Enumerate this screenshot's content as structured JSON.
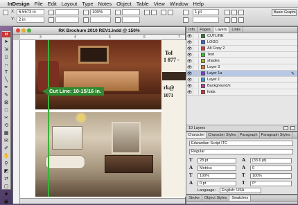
{
  "menubar": {
    "items": [
      "InDesign",
      "File",
      "Edit",
      "Layout",
      "Type",
      "Notes",
      "Object",
      "Table",
      "View",
      "Window",
      "Help"
    ]
  },
  "control": {
    "x_label": "X:",
    "x_value": "6.5573 in",
    "y_label": "Y:",
    "y_value": "2 in",
    "zoom": "100%",
    "stroke_weight": "1 pt",
    "workspace": "Basic Graphics"
  },
  "document": {
    "title": "RK Brochure 2010 REV1.indd @ 150%",
    "ruler_marks": [
      "3",
      "4",
      "5",
      "6",
      "7"
    ],
    "cut_line": "Cut Line: 10-15/16 in.",
    "side_text": [
      "Tol",
      "1 877 -",
      "rk@",
      "1071"
    ]
  },
  "layers_panel": {
    "tabs": [
      "Info",
      "Pages",
      "Layers",
      "Links"
    ],
    "layers": [
      {
        "name": "CUTLINE",
        "color": "#2f7f2f"
      },
      {
        "name": "LOGO",
        "color": "#3a5fcf"
      },
      {
        "name": "Alt Copy 2",
        "color": "#d03a3a"
      },
      {
        "name": "Text",
        "color": "#3ac03a"
      },
      {
        "name": "shades",
        "color": "#b0b030"
      },
      {
        "name": "Layer 3",
        "color": "#d07a30"
      },
      {
        "name": "Layer 1a",
        "color": "#7a3ad0",
        "selected": true
      },
      {
        "name": "Layer 1",
        "color": "#3a9ad0"
      },
      {
        "name": "Background/s",
        "color": "#c03aa0"
      },
      {
        "name": "folds",
        "color": "#d03030"
      }
    ],
    "footer": "10 Layers"
  },
  "character_panel": {
    "tabs": [
      "Character",
      "Character Styles",
      "Paragraph",
      "Paragraph Styles"
    ],
    "font_family": "Edwardian Script ITC",
    "font_style": "Regular",
    "size": "28 pt",
    "leading": "(33.6 pt)",
    "kerning": "Metrics",
    "tracking": "0",
    "vscale": "100%",
    "hscale": "100%",
    "baseline": "0 pt",
    "skew": "0°",
    "language_label": "Language:",
    "language": "English: USA"
  },
  "bottom_tabs": [
    "Stroke",
    "Object Styles",
    "Swatches"
  ]
}
